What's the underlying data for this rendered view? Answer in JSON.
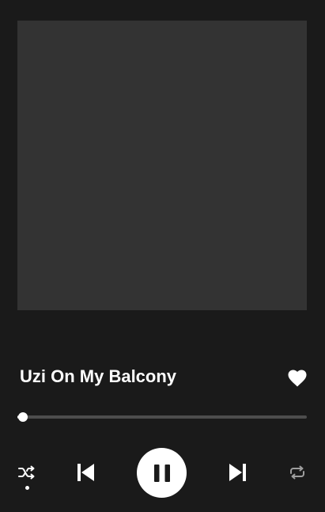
{
  "player": {
    "track_title": "Uzi On My Balcony",
    "liked": true,
    "progress_fraction": 0.02,
    "shuffle_enabled": true,
    "state": "playing"
  },
  "icons": {
    "like": "heart-icon",
    "shuffle": "shuffle-icon",
    "previous": "skip-previous-icon",
    "play_pause": "pause-icon",
    "next": "skip-next-icon",
    "repeat": "repeat-icon"
  },
  "colors": {
    "background": "#1a1a1a",
    "artwork_placeholder": "#333333",
    "foreground": "#ffffff",
    "progress_track": "#4d4d4d",
    "inactive_icon": "#9e9e9e"
  }
}
